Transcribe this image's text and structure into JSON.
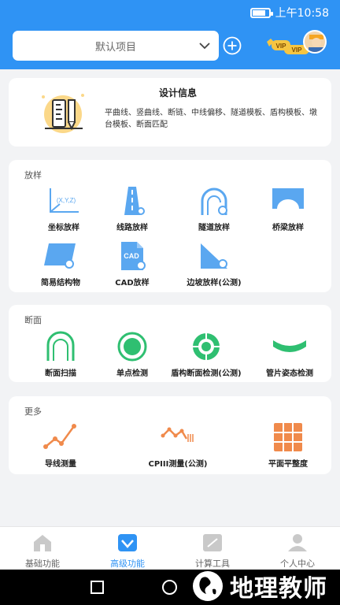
{
  "status_bar": {
    "time": "上午10:58",
    "battery_level": 0.8
  },
  "header": {
    "project_select": {
      "value": "默认项目"
    },
    "vip_badge": "VIP",
    "colors": {
      "primary": "#2f93f4",
      "gold": "#f5c542"
    }
  },
  "design_info": {
    "title": "设计信息",
    "description": "平曲线、竖曲线、断链、中线偏移、隧道模板、盾构模板、墩台模板、断面匹配"
  },
  "sections": {
    "stakeout": {
      "title": "放样",
      "items": [
        {
          "label": "坐标放样",
          "icon": "coordinate-axes-icon",
          "icon_text": "(X,Y,Z)"
        },
        {
          "label": "线路放样",
          "icon": "road-lane-icon"
        },
        {
          "label": "隧道放样",
          "icon": "tunnel-icon"
        },
        {
          "label": "桥梁放样",
          "icon": "bridge-icon"
        },
        {
          "label": "简易结构物",
          "icon": "simple-structure-icon"
        },
        {
          "label": "CAD放样",
          "icon": "cad-file-icon",
          "icon_text": "CAD"
        },
        {
          "label": "边坡放样(公测)",
          "icon": "slope-icon"
        }
      ]
    },
    "section": {
      "title": "断面",
      "items": [
        {
          "label": "断面扫描",
          "icon": "tunnel-section-scan-icon"
        },
        {
          "label": "单点检测",
          "icon": "single-point-target-icon"
        },
        {
          "label": "盾构断面检测(公测)",
          "icon": "shield-ring-section-icon"
        },
        {
          "label": "管片姿态检测",
          "icon": "segment-arc-icon"
        }
      ]
    },
    "more": {
      "title": "更多",
      "items": [
        {
          "label": "导线测量",
          "icon": "traverse-line-icon"
        },
        {
          "label": "CPIII测量(公测)",
          "icon": "cpiii-line-icon"
        },
        {
          "label": "平面平整度",
          "icon": "flatness-grid-icon"
        }
      ]
    }
  },
  "tabbar": {
    "tabs": [
      {
        "label": "基础功能",
        "icon": "home-icon"
      },
      {
        "label": "高级功能",
        "icon": "diamond-icon",
        "active": true
      },
      {
        "label": "计算工具",
        "icon": "calculator-icon"
      },
      {
        "label": "个人中心",
        "icon": "user-icon"
      }
    ]
  },
  "watermark": {
    "text": "地理教师"
  }
}
